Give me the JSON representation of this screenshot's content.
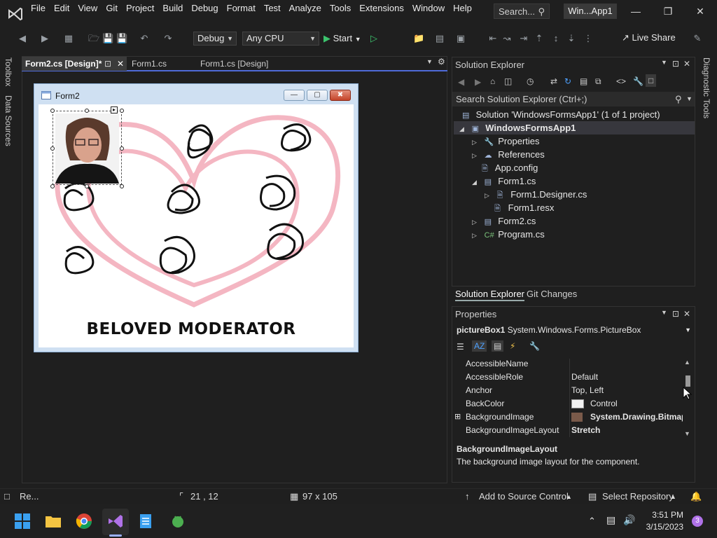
{
  "menu": [
    "File",
    "Edit",
    "View",
    "Git",
    "Project",
    "Build",
    "Debug",
    "Format",
    "Test",
    "Analyze",
    "Tools",
    "Extensions",
    "Window",
    "Help"
  ],
  "search_label": "Search...",
  "solution_short": "Win...App1",
  "toolbar": {
    "config": "Debug",
    "platform": "Any CPU",
    "start": "Start",
    "live_share": "Live Share"
  },
  "left_tabs": [
    "Toolbox",
    "Data Sources"
  ],
  "right_tabs": [
    "Diagnostic Tools"
  ],
  "doc_tabs": [
    "Form2.cs [Design]*",
    "Form1.cs",
    "Form1.cs [Design]"
  ],
  "form": {
    "title": "Form2",
    "caption": "BELOVED MODERATOR"
  },
  "solution_explorer": {
    "title": "Solution Explorer",
    "search_placeholder": "Search Solution Explorer (Ctrl+;)",
    "tree": [
      {
        "label": "Solution 'WindowsFormsApp1' (1 of 1 project)",
        "icon": "solution-icon"
      },
      {
        "label": "WindowsFormsApp1",
        "icon": "csharp-project-icon"
      },
      {
        "label": "Properties",
        "icon": "wrench-icon"
      },
      {
        "label": "References",
        "icon": "references-icon"
      },
      {
        "label": "App.config",
        "icon": "config-icon"
      },
      {
        "label": "Form1.cs",
        "icon": "form-icon"
      },
      {
        "label": "Form1.Designer.cs",
        "icon": "file-icon"
      },
      {
        "label": "Form1.resx",
        "icon": "file-icon"
      },
      {
        "label": "Form2.cs",
        "icon": "form-icon"
      },
      {
        "label": "Program.cs",
        "icon": "csharp-file-icon"
      }
    ],
    "tabs": [
      "Solution Explorer",
      "Git Changes"
    ]
  },
  "properties": {
    "title": "Properties",
    "object_name": "pictureBox1",
    "object_type": "System.Windows.Forms.PictureBox",
    "rows": [
      {
        "name": "AccessibleName",
        "value": ""
      },
      {
        "name": "AccessibleRole",
        "value": "Default"
      },
      {
        "name": "Anchor",
        "value": "Top, Left"
      },
      {
        "name": "BackColor",
        "value": "Control"
      },
      {
        "name": "BackgroundImage",
        "value": "System.Drawing.Bitmap"
      },
      {
        "name": "BackgroundImageLayout",
        "value": "Stretch"
      }
    ],
    "desc_title": "BackgroundImageLayout",
    "desc_text": "The background image layout for the component."
  },
  "status": {
    "ready": "Re...",
    "position": "21 , 12",
    "size": "97 x 105",
    "add_source": "Add to Source Control",
    "select_repo": "Select Repository"
  },
  "taskbar": {
    "time": "3:51 PM",
    "date": "3/15/2023",
    "notif_count": "3"
  },
  "colors": {
    "accent": "#4f6bd8",
    "heart": "#f4b6c2",
    "selection_bg": "#37373d"
  }
}
